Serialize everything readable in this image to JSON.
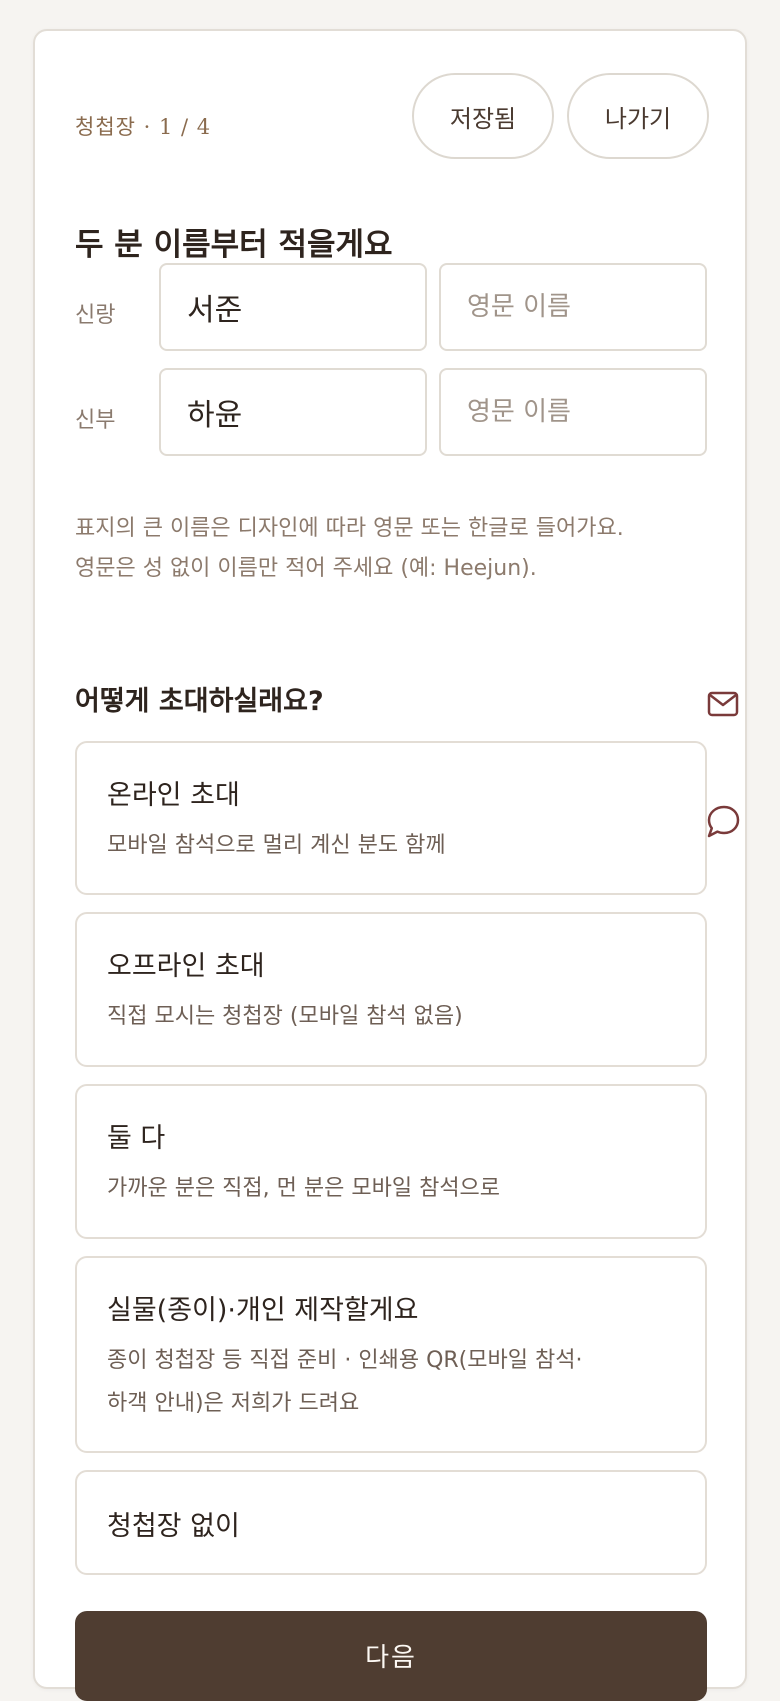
{
  "header": {
    "step_label": "청첩장 · 1 / 4",
    "saved_label": "저장됨",
    "exit_label": "나가기"
  },
  "names_section": {
    "title": "두 분 이름부터 적을게요",
    "groom": {
      "label": "신랑",
      "korean_value": "서준",
      "english_placeholder": "영문 이름"
    },
    "bride": {
      "label": "신부",
      "korean_value": "하윤",
      "english_placeholder": "영문 이름"
    },
    "hint_line1": "표지의 큰 이름은 디자인에 따라 영문 또는 한글로 들어가요.",
    "hint_line2": "영문은 성 없이 이름만 적어 주세요 (예: Heejun)."
  },
  "invite_section": {
    "title": "어떻게 초대하실래요?",
    "options": [
      {
        "title": "온라인 초대",
        "desc": "모바일 참석으로 멀리 계신 분도 함께"
      },
      {
        "title": "오프라인 초대",
        "desc": "직접 모시는 청첩장 (모바일 참석 없음)"
      },
      {
        "title": "둘 다",
        "desc": "가까운 분은 직접, 먼 분은 모바일 참석으로"
      },
      {
        "title": "실물(종이)·개인 제작할게요",
        "desc_line1": "종이 청첩장 등 직접 준비 · 인쇄용 QR(모바일 참석·",
        "desc_line2": "하객 안내)은 저희가 드려요"
      },
      {
        "title": "청첩장 없이"
      }
    ]
  },
  "next_label": "다음",
  "colors": {
    "accent": "#4f3d31",
    "icon": "#7a3a3a",
    "label": "#8a6b4e"
  },
  "icons": {
    "mail": "mail-icon",
    "chat": "chat-bubble-icon"
  }
}
